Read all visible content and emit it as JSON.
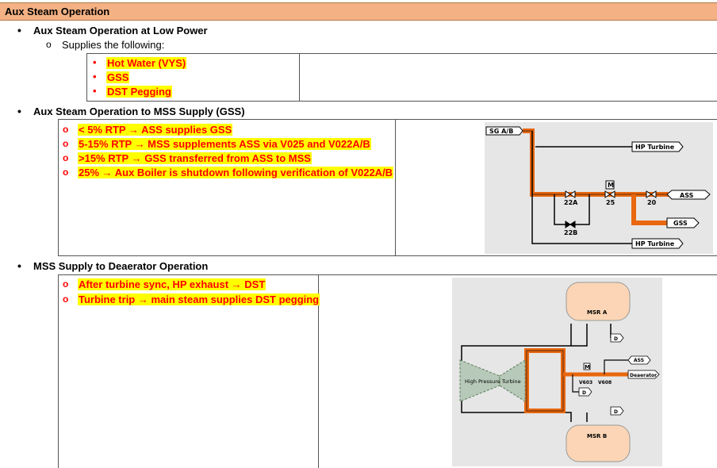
{
  "header": {
    "title": "Aux Steam Operation"
  },
  "section1": {
    "heading": "Aux Steam Operation at Low Power",
    "sub": "Supplies the following:",
    "items": [
      "Hot Water (VYS)",
      "GSS",
      "DST Pegging"
    ]
  },
  "section2": {
    "heading": "Aux Steam Operation to MSS Supply (GSS)",
    "items": [
      "< 5% RTP → ASS supplies GSS",
      "5-15% RTP → MSS supplements ASS via V025 and V022A/B",
      ">15% RTP → GSS transferred from ASS to MSS",
      "25% → Aux Boiler is shutdown following verification of V022A/B"
    ],
    "diagram": {
      "sg_label": "SG A/B",
      "hp_turbine_top": "HP Turbine",
      "hp_turbine_bottom": "HP Turbine",
      "ass": "ASS",
      "gss": "GSS",
      "valve_22a": "22A",
      "valve_22b": "22B",
      "valve_25": "25",
      "valve_20": "20",
      "motor": "M"
    }
  },
  "section3": {
    "heading": "MSS Supply to Deaerator Operation",
    "items": [
      "After turbine sync, HP exhaust → DST",
      "Turbine trip → main steam supplies DST pegging"
    ],
    "diagram": {
      "msr_a": "MSR A",
      "msr_b": "MSR B",
      "turbine": "High Pressure Turbine",
      "ass": "ASS",
      "deaerator": "Deaerator",
      "v603": "V603",
      "v608": "V608",
      "motor": "M",
      "drain": "D"
    }
  },
  "colors": {
    "header_bg": "#f4b183",
    "highlight": "#ffff00",
    "text_red": "#ff0000",
    "pipe_orange": "#e8670f"
  }
}
